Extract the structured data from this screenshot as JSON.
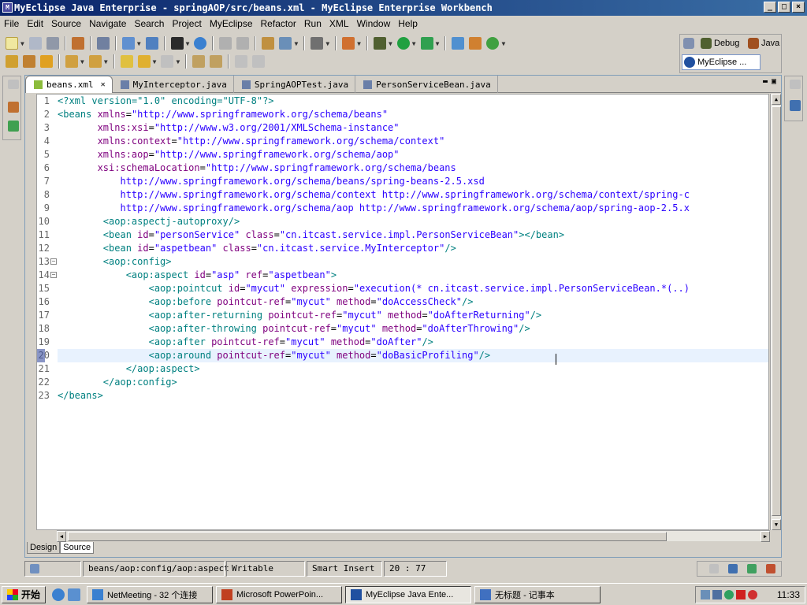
{
  "window": {
    "title": "MyEclipse Java Enterprise - springAOP/src/beans.xml - MyEclipse Enterprise Workbench",
    "minimize": "_",
    "maximize": "□",
    "close": "×"
  },
  "menu": [
    "File",
    "Edit",
    "Source",
    "Navigate",
    "Search",
    "Project",
    "MyEclipse",
    "Refactor",
    "Run",
    "XML",
    "Window",
    "Help"
  ],
  "perspectives": {
    "debug": "Debug",
    "java": "Java",
    "myeclipse": "MyEclipse ..."
  },
  "tabs": [
    {
      "label": "beans.xml",
      "active": true,
      "icon": "xml-file-icon"
    },
    {
      "label": "MyInterceptor.java",
      "active": false,
      "icon": "java-file-icon"
    },
    {
      "label": "SpringAOPTest.java",
      "active": false,
      "icon": "java-file-icon"
    },
    {
      "label": "PersonServiceBean.java",
      "active": false,
      "icon": "java-file-icon"
    }
  ],
  "code": [
    [
      {
        "t": "<?xml version=\"1.0\" encoding=\"UTF-8\"?>",
        "c": "pic"
      }
    ],
    [
      {
        "t": "<beans ",
        "c": "tagc"
      },
      {
        "t": "xmlns",
        "c": "attrc"
      },
      {
        "t": "=",
        "c": ""
      },
      {
        "t": "\"http://www.springframework.org/schema/beans\"",
        "c": "valc"
      }
    ],
    [
      {
        "t": "       xmlns:xsi",
        "c": "attrc"
      },
      {
        "t": "=",
        "c": ""
      },
      {
        "t": "\"http://www.w3.org/2001/XMLSchema-instance\"",
        "c": "valc"
      }
    ],
    [
      {
        "t": "       xmlns:context",
        "c": "attrc"
      },
      {
        "t": "=",
        "c": ""
      },
      {
        "t": "\"http://www.springframework.org/schema/context\"",
        "c": "valc"
      }
    ],
    [
      {
        "t": "       xmlns:aop",
        "c": "attrc"
      },
      {
        "t": "=",
        "c": ""
      },
      {
        "t": "\"http://www.springframework.org/schema/aop\"",
        "c": "valc"
      }
    ],
    [
      {
        "t": "       xsi:schemaLocation",
        "c": "attrc"
      },
      {
        "t": "=",
        "c": ""
      },
      {
        "t": "\"http://www.springframework.org/schema/beans",
        "c": "valc"
      }
    ],
    [
      {
        "t": "           http://www.springframework.org/schema/beans/spring-beans-2.5.xsd",
        "c": "valc"
      }
    ],
    [
      {
        "t": "           http://www.springframework.org/schema/context http://www.springframework.org/schema/context/spring-c",
        "c": "valc"
      }
    ],
    [
      {
        "t": "           http://www.springframework.org/schema/aop http://www.springframework.org/schema/aop/spring-aop-2.5.x",
        "c": "valc"
      }
    ],
    [
      {
        "t": "        <aop:aspectj-autoproxy/>",
        "c": "tagc"
      }
    ],
    [
      {
        "t": "        <bean ",
        "c": "tagc"
      },
      {
        "t": "id",
        "c": "attrc"
      },
      {
        "t": "=",
        "c": ""
      },
      {
        "t": "\"personService\"",
        "c": "valc"
      },
      {
        "t": " class",
        "c": "attrc"
      },
      {
        "t": "=",
        "c": ""
      },
      {
        "t": "\"cn.itcast.service.impl.PersonServiceBean\"",
        "c": "valc"
      },
      {
        "t": "></bean>",
        "c": "tagc"
      }
    ],
    [
      {
        "t": "        <bean ",
        "c": "tagc"
      },
      {
        "t": "id",
        "c": "attrc"
      },
      {
        "t": "=",
        "c": ""
      },
      {
        "t": "\"aspetbean\"",
        "c": "valc"
      },
      {
        "t": " class",
        "c": "attrc"
      },
      {
        "t": "=",
        "c": ""
      },
      {
        "t": "\"cn.itcast.service.MyInterceptor\"",
        "c": "valc"
      },
      {
        "t": "/>",
        "c": "tagc"
      }
    ],
    [
      {
        "t": "        <aop:config>",
        "c": "tagc"
      }
    ],
    [
      {
        "t": "            <aop:aspect ",
        "c": "tagc"
      },
      {
        "t": "id",
        "c": "attrc"
      },
      {
        "t": "=",
        "c": ""
      },
      {
        "t": "\"asp\"",
        "c": "valc"
      },
      {
        "t": " ref",
        "c": "attrc"
      },
      {
        "t": "=",
        "c": ""
      },
      {
        "t": "\"aspetbean\"",
        "c": "valc"
      },
      {
        "t": ">",
        "c": "tagc"
      }
    ],
    [
      {
        "t": "                <aop:pointcut ",
        "c": "tagc"
      },
      {
        "t": "id",
        "c": "attrc"
      },
      {
        "t": "=",
        "c": ""
      },
      {
        "t": "\"mycut\"",
        "c": "valc"
      },
      {
        "t": " expression",
        "c": "attrc"
      },
      {
        "t": "=",
        "c": ""
      },
      {
        "t": "\"execution(* cn.itcast.service.impl.PersonServiceBean.*(..)",
        "c": "valc"
      }
    ],
    [
      {
        "t": "                <aop:before ",
        "c": "tagc"
      },
      {
        "t": "pointcut-ref",
        "c": "attrc"
      },
      {
        "t": "=",
        "c": ""
      },
      {
        "t": "\"mycut\"",
        "c": "valc"
      },
      {
        "t": " method",
        "c": "attrc"
      },
      {
        "t": "=",
        "c": ""
      },
      {
        "t": "\"doAccessCheck\"",
        "c": "valc"
      },
      {
        "t": "/>",
        "c": "tagc"
      }
    ],
    [
      {
        "t": "                <aop:after-returning ",
        "c": "tagc"
      },
      {
        "t": "pointcut-ref",
        "c": "attrc"
      },
      {
        "t": "=",
        "c": ""
      },
      {
        "t": "\"mycut\"",
        "c": "valc"
      },
      {
        "t": " method",
        "c": "attrc"
      },
      {
        "t": "=",
        "c": ""
      },
      {
        "t": "\"doAfterReturning\"",
        "c": "valc"
      },
      {
        "t": "/>",
        "c": "tagc"
      }
    ],
    [
      {
        "t": "                <aop:after-throwing ",
        "c": "tagc"
      },
      {
        "t": "pointcut-ref",
        "c": "attrc"
      },
      {
        "t": "=",
        "c": ""
      },
      {
        "t": "\"mycut\"",
        "c": "valc"
      },
      {
        "t": " method",
        "c": "attrc"
      },
      {
        "t": "=",
        "c": ""
      },
      {
        "t": "\"doAfterThrowing\"",
        "c": "valc"
      },
      {
        "t": "/>",
        "c": "tagc"
      }
    ],
    [
      {
        "t": "                <aop:after ",
        "c": "tagc"
      },
      {
        "t": "pointcut-ref",
        "c": "attrc"
      },
      {
        "t": "=",
        "c": ""
      },
      {
        "t": "\"mycut\"",
        "c": "valc"
      },
      {
        "t": " method",
        "c": "attrc"
      },
      {
        "t": "=",
        "c": ""
      },
      {
        "t": "\"doAfter\"",
        "c": "valc"
      },
      {
        "t": "/>",
        "c": "tagc"
      }
    ],
    [
      {
        "t": "                <aop:around ",
        "c": "tagc"
      },
      {
        "t": "pointcut-ref",
        "c": "attrc"
      },
      {
        "t": "=",
        "c": ""
      },
      {
        "t": "\"mycut\"",
        "c": "valc"
      },
      {
        "t": " method",
        "c": "attrc"
      },
      {
        "t": "=",
        "c": ""
      },
      {
        "t": "\"doBasicProfiling\"",
        "c": "valc"
      },
      {
        "t": "/>",
        "c": "tagc"
      }
    ],
    [
      {
        "t": "            </aop:aspect>",
        "c": "tagc"
      }
    ],
    [
      {
        "t": "        </aop:config>",
        "c": "tagc"
      }
    ],
    [
      {
        "t": "</beans>",
        "c": "tagc"
      }
    ]
  ],
  "fold_lines": [
    13,
    14
  ],
  "highlight_line": 20,
  "editor_tabs": {
    "design": "Design",
    "source": "Source"
  },
  "status": {
    "path": "beans/aop:config/aop:aspect",
    "mode": "Writable",
    "insert": "Smart Insert",
    "position": "20 : 77"
  },
  "taskbar": {
    "start": "开始",
    "tasks": [
      {
        "label": "NetMeeting - 32 个连接",
        "active": false
      },
      {
        "label": "Microsoft PowerPoin...",
        "active": false
      },
      {
        "label": "MyEclipse Java Ente...",
        "active": true
      },
      {
        "label": "无标题 - 记事本",
        "active": false
      }
    ],
    "clock": "11:33"
  },
  "colors": {
    "title_start": "#0a246a",
    "title_end": "#3a6ea5",
    "tag": "#008080",
    "attr": "#7f007f",
    "value": "#2a00ff",
    "current_line": "#e8f2fe"
  }
}
